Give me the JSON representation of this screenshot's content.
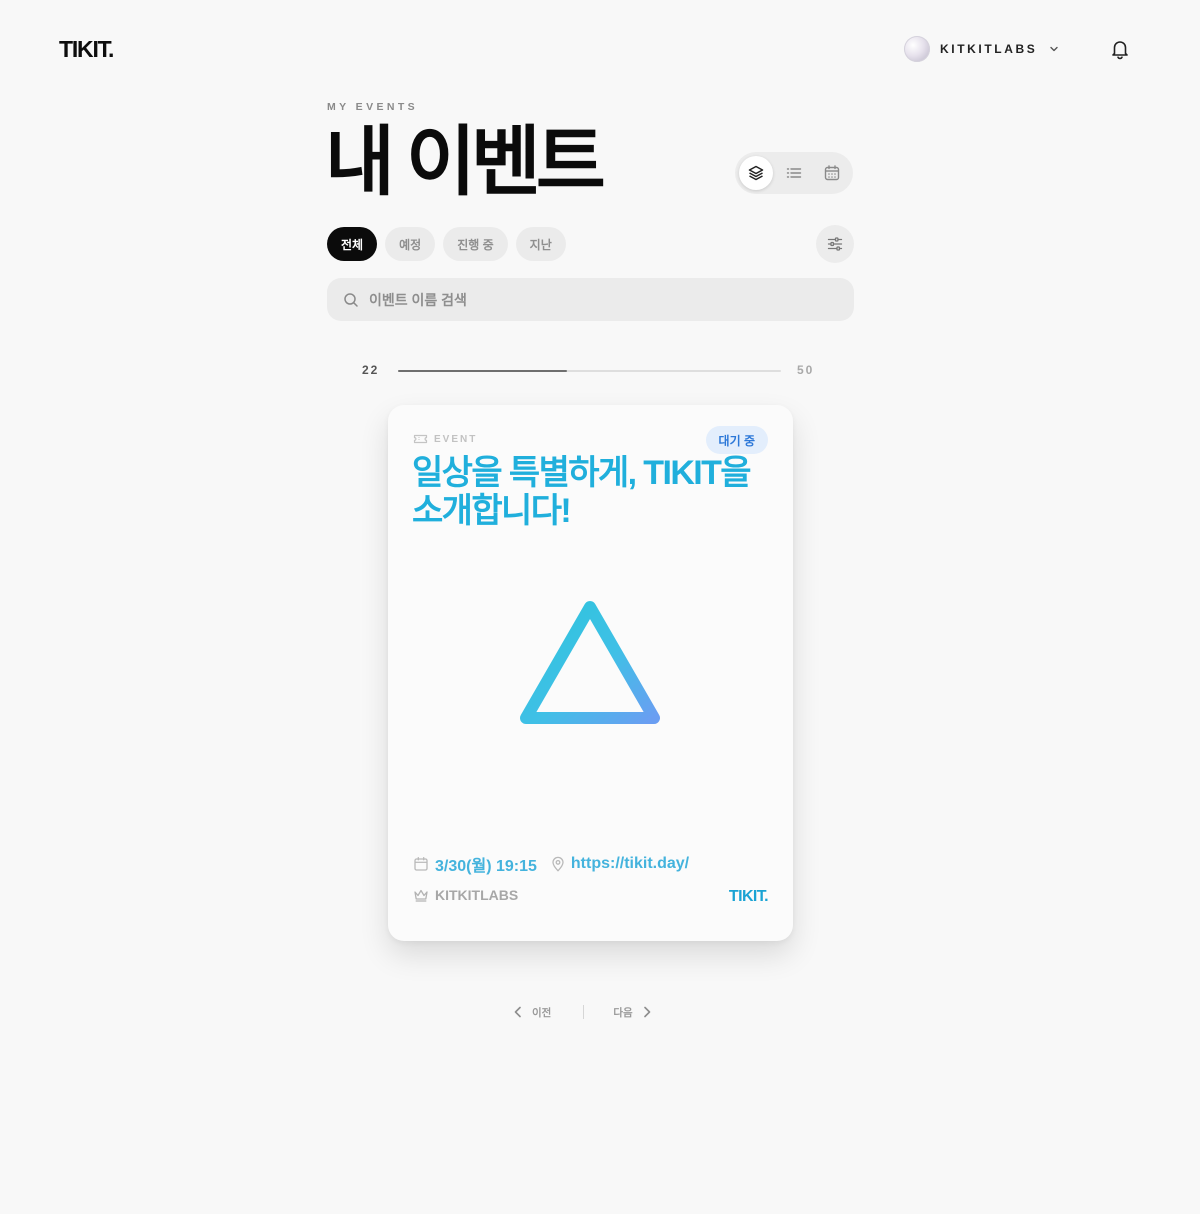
{
  "header": {
    "logo": "TIKIT.",
    "user": {
      "name": "KITKITLABS"
    }
  },
  "page": {
    "eyebrow": "MY EVENTS",
    "title": "내 이벤트"
  },
  "view_modes": [
    {
      "icon": "layers-icon",
      "active": true
    },
    {
      "icon": "list-icon",
      "active": false
    },
    {
      "icon": "calendar-icon",
      "active": false
    }
  ],
  "tabs": [
    {
      "label": "전체",
      "active": true
    },
    {
      "label": "예정",
      "active": false
    },
    {
      "label": "진행 중",
      "active": false
    },
    {
      "label": "지난",
      "active": false
    }
  ],
  "search": {
    "placeholder": "이벤트 이름 검색",
    "value": ""
  },
  "progress": {
    "current": "22",
    "total": "50",
    "fraction": 0.44
  },
  "event_card": {
    "type_label": "EVENT",
    "status_badge": "대기 중",
    "title": "일상을 특별하게, TIKIT을 소개합니다!",
    "datetime": "3/30(월) 19:15",
    "location": "https://tikit.day/",
    "host": "KITKITLABS",
    "brand": "TIKIT.",
    "accent_color": "#20afdc"
  },
  "pagination": {
    "prev_label": "이전",
    "next_label": "다음"
  }
}
